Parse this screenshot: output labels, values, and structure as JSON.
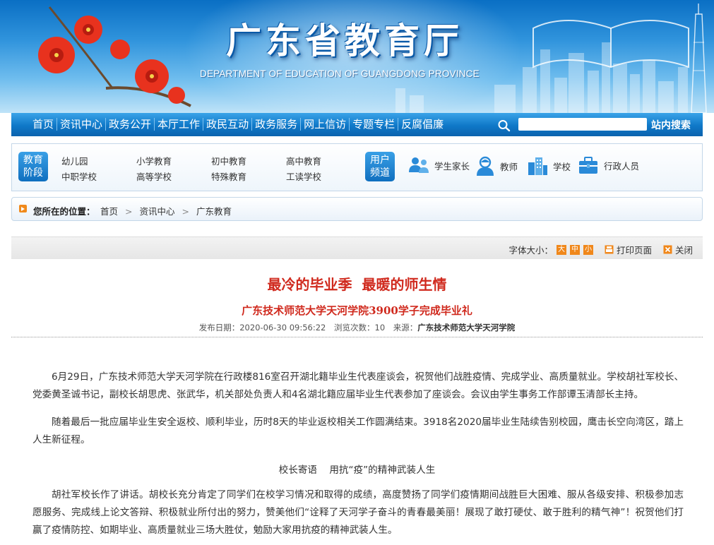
{
  "site": {
    "title": "广东省教育厅",
    "subtitle": "DEPARTMENT OF EDUCATION OF GUANGDONG PROVINCE"
  },
  "nav": {
    "items": [
      "首页",
      "资讯中心",
      "政务公开",
      "本厅工作",
      "政民互动",
      "政务服务",
      "网上信访",
      "专题专栏",
      "反腐倡廉"
    ],
    "search_placeholder": "",
    "search_button": "站内搜索"
  },
  "education": {
    "tag": [
      "教育",
      "阶段"
    ],
    "links": [
      "幼儿园",
      "小学教育",
      "初中教育",
      "高中教育",
      "中职学校",
      "高等学校",
      "特殊教育",
      "工读学校"
    ]
  },
  "users": {
    "tag": [
      "用户",
      "频道"
    ],
    "items": [
      {
        "label": "学生家长",
        "icon": "parents-icon"
      },
      {
        "label": "教师",
        "icon": "teacher-icon"
      },
      {
        "label": "学校",
        "icon": "school-icon"
      },
      {
        "label": "行政人员",
        "icon": "briefcase-icon"
      }
    ]
  },
  "breadcrumb": {
    "label": "您所在的位置：",
    "items": [
      "首页",
      "资讯中心",
      "广东教育"
    ]
  },
  "tools": {
    "font_size_label": "字体大小：",
    "sizes": [
      "大",
      "中",
      "小"
    ],
    "print": "打印页面",
    "close": "关闭"
  },
  "article": {
    "title": "最冷的毕业季  最暖的师生情",
    "subtitle": "广东技术师范大学天河学院3900学子完成毕业礼",
    "meta": {
      "date_label": "发布日期：",
      "date": "2020-06-30 09:56:22",
      "views_label": "浏览次数：",
      "views": "10",
      "source_label": "来源：",
      "source": "广东技术师范大学天河学院"
    },
    "p1": "6月29日，广东技术师范大学天河学院在行政楼816室召开湖北籍毕业生代表座谈会，祝贺他们战胜疫情、完成学业、高质量就业。学校胡社军校长、党委黄圣诚书记，副校长胡思虎、张武华，机关部处负责人和4名湖北籍应届毕业生代表参加了座谈会。会议由学生事务工作部谭玉清部长主持。",
    "p2": "随着最后一批应届毕业生安全返校、顺利毕业，历时8天的毕业返校相关工作圆满结束。3918名2020届毕业生陆续告别校园，鹰击长空向湾区，踏上人生新征程。",
    "section_heading": "校长寄语    用抗“疫”的精神武装人生",
    "p3": "胡社军校长作了讲话。胡校长充分肯定了同学们在校学习情况和取得的成绩，高度赞扬了同学们疫情期间战胜巨大困难、服从各级安排、积极参加志愿服务、完成线上论文答辩、积极就业所付出的努力，赞美他们“诠释了天河学子奋斗的青春最美丽！展现了敢打硬仗、敢于胜利的精气神”！祝贺他们打赢了疫情防控、如期毕业、高质量就业三场大胜仗，勉励大家用抗疫的精神武装人生。"
  },
  "colors": {
    "accent_blue": "#0f78c8",
    "title_red": "#d02a1e",
    "font_size_orange": "#f0871a"
  }
}
